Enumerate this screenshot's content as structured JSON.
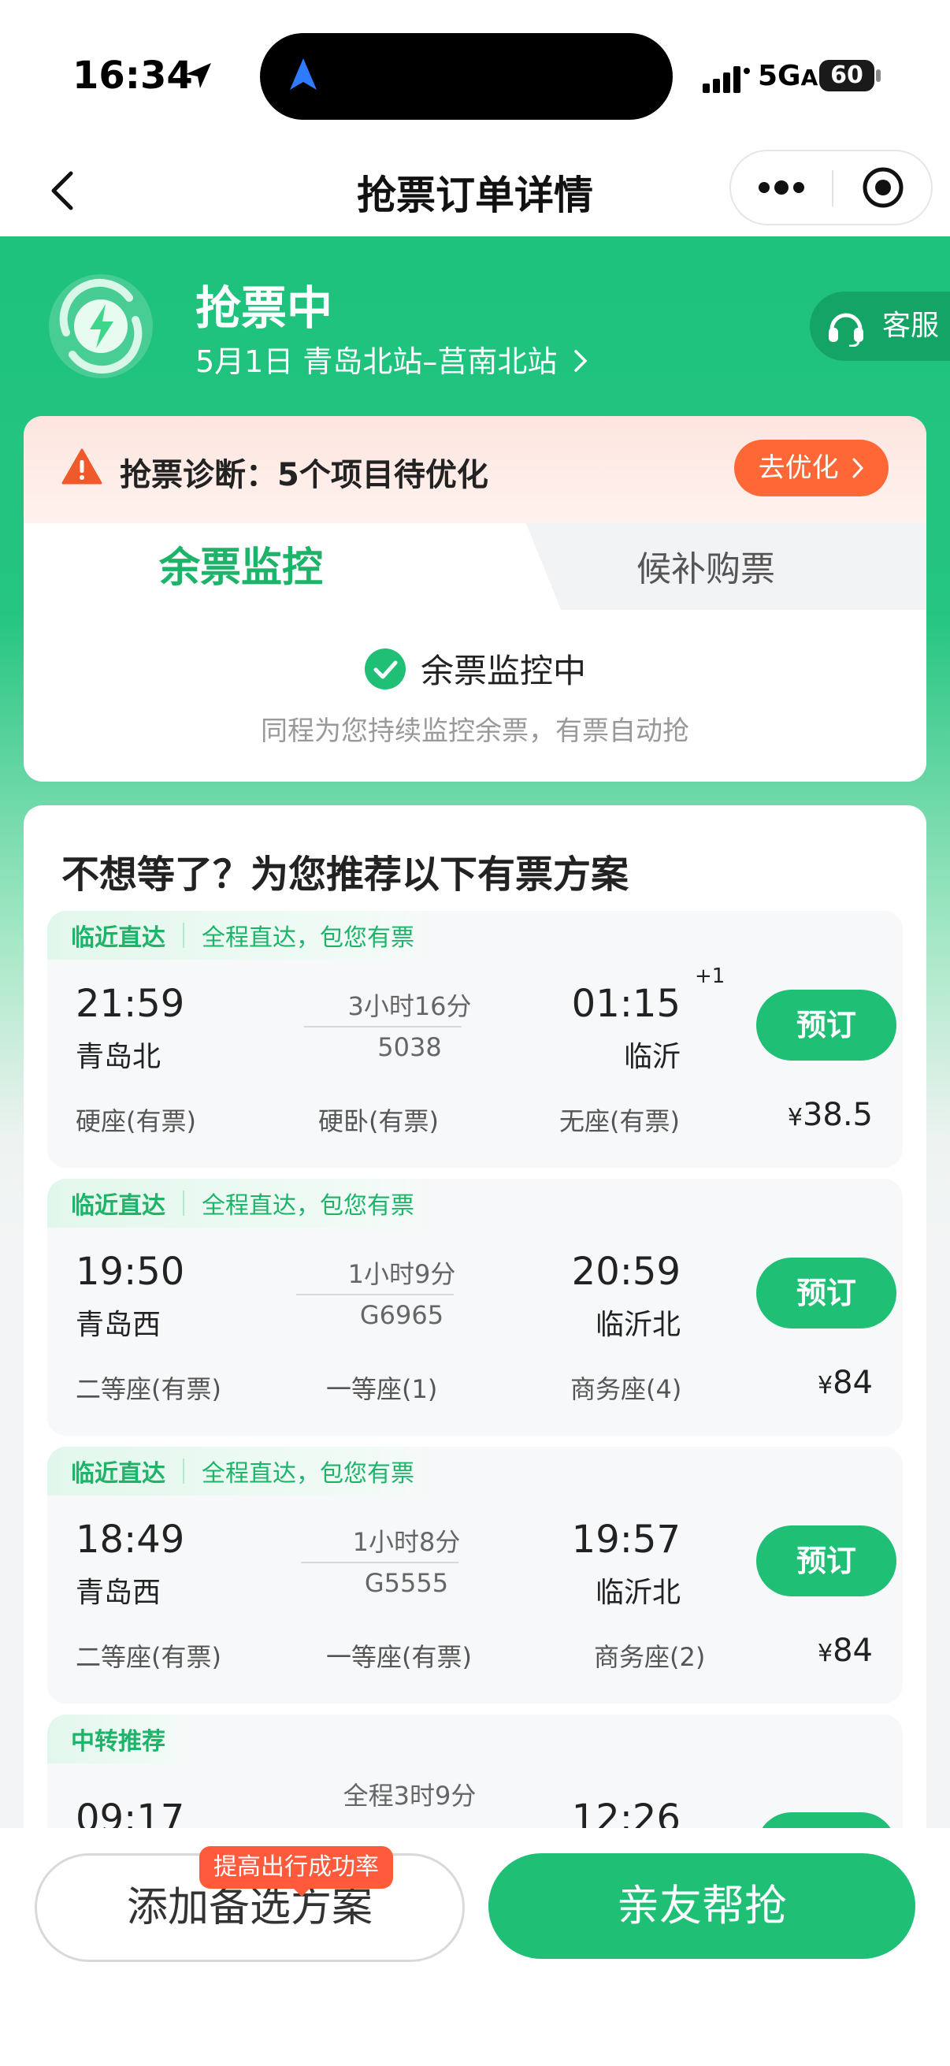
{
  "status_bar": {
    "time": "16:34",
    "network": "5G",
    "network_suffix": "A",
    "battery": "60"
  },
  "nav": {
    "title": "抢票订单详情"
  },
  "header": {
    "status_title": "抢票中",
    "route": "5月1日  青岛北站–莒南北站",
    "customer_service": "客服"
  },
  "diagnosis": {
    "text": "抢票诊断：5个项目待优化",
    "button": "去优化"
  },
  "tabs": [
    {
      "label": "余票监控"
    },
    {
      "label": "候补购票"
    }
  ],
  "monitor": {
    "status": "余票监控中",
    "subtitle": "同程为您持续监控余票，有票自动抢"
  },
  "recommend": {
    "title": "不想等了？为您推荐以下有票方案",
    "trains": [
      {
        "tag": "临近直达",
        "tag_note": "全程直达，包您有票",
        "dep_time": "21:59",
        "dep_station": "青岛北",
        "duration": "3小时16分",
        "train_no": "5038",
        "arr_time": "01:15",
        "arr_plus": "+1",
        "arr_station": "临沂",
        "book": "预订",
        "seats": [
          "硬座(有票)",
          "硬卧(有票)",
          "无座(有票)"
        ],
        "price_symbol": "¥",
        "price": "38.5"
      },
      {
        "tag": "临近直达",
        "tag_note": "全程直达，包您有票",
        "dep_time": "19:50",
        "dep_station": "青岛西",
        "duration": "1小时9分",
        "train_no": "G6965",
        "arr_time": "20:59",
        "arr_plus": "",
        "arr_station": "临沂北",
        "book": "预订",
        "seats": [
          "二等座(有票)",
          "一等座(1)",
          "商务座(4)"
        ],
        "price_symbol": "¥",
        "price": "84"
      },
      {
        "tag": "临近直达",
        "tag_note": "全程直达，包您有票",
        "dep_time": "18:49",
        "dep_station": "青岛西",
        "duration": "1小时8分",
        "train_no": "G5555",
        "arr_time": "19:57",
        "arr_plus": "",
        "arr_station": "临沂北",
        "book": "预订",
        "seats": [
          "二等座(有票)",
          "一等座(有票)",
          "商务座(2)"
        ],
        "price_symbol": "¥",
        "price": "84"
      }
    ],
    "transfer": {
      "tag": "中转推荐",
      "dep_time": "09:17",
      "duration": "全程3时9分",
      "arr_time": "12:26"
    }
  },
  "bottom": {
    "alt_tip": "提高出行成功率",
    "alt_button": "添加备选方案",
    "friend_button": "亲友帮抢"
  },
  "colors": {
    "brand_green": "#1fbf76",
    "warning_orange": "#ff6836",
    "tip_red": "#ff5a3c"
  }
}
